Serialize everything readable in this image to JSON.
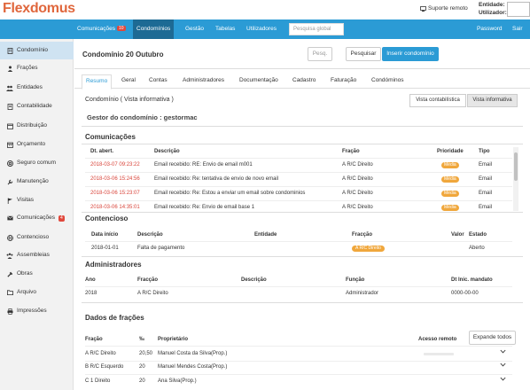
{
  "brand": {
    "part1": "Flex",
    "part2": "domus"
  },
  "topbar": {
    "remote_label": "Suporte remoto",
    "entity_label": "Entidade:",
    "user_label": "Utilizador:"
  },
  "nav": {
    "items": [
      {
        "label": "Comunicações",
        "badge": "10"
      },
      {
        "label": "Condomínios"
      },
      {
        "label": "Gestão"
      },
      {
        "label": "Tabelas"
      },
      {
        "label": "Utilizadores"
      }
    ],
    "search_placeholder": "Pesquisa global",
    "password": "Password",
    "logout": "Sair"
  },
  "sidebar": {
    "items": [
      {
        "label": "Condomínio",
        "icon": "building-icon"
      },
      {
        "label": "Frações",
        "icon": "user-icon"
      },
      {
        "label": "Entidades",
        "icon": "users-icon"
      },
      {
        "label": "Contabilidade",
        "icon": "book-icon"
      },
      {
        "label": "Distribuição",
        "icon": "calendar-icon"
      },
      {
        "label": "Orçamento",
        "icon": "calendar-icon"
      },
      {
        "label": "Seguro comum",
        "icon": "lifebuoy-icon"
      },
      {
        "label": "Manutenção",
        "icon": "wrench-icon"
      },
      {
        "label": "Visitas",
        "icon": "flag-icon"
      },
      {
        "label": "Comunicações",
        "icon": "envelope-icon",
        "badge": "4"
      },
      {
        "label": "Contencioso",
        "icon": "globe-icon"
      },
      {
        "label": "Assembleias",
        "icon": "group-icon"
      },
      {
        "label": "Obras",
        "icon": "tools-icon"
      },
      {
        "label": "Arquivo",
        "icon": "folder-icon"
      },
      {
        "label": "Impressões",
        "icon": "print-icon"
      }
    ]
  },
  "page": {
    "title": "Condomínio 20 Outubro",
    "search_placeholder": "Pesq.",
    "search_button": "Pesquisar",
    "insert_button": "Inserir condomínio"
  },
  "tabs": [
    "Resumo",
    "Geral",
    "Contas",
    "Administradores",
    "Documentação",
    "Cadastro",
    "Faturação",
    "Condóminos"
  ],
  "view": {
    "label": "Condomínio ( Vista informativa )",
    "btn_accounting": "Vista contabilística",
    "btn_info": "Vista informativa"
  },
  "gestor": "Gestor do condomínio : gestormac",
  "comunicacoes": {
    "title": "Comunicações",
    "headers": [
      "Dt. abert.",
      "Descrição",
      "Fração",
      "Prioridade",
      "Tipo"
    ],
    "rows": [
      {
        "date": "2018-03-07 09:23:22",
        "desc": "Email recebido: RE: Envio de email m001",
        "fracao": "A R/C Direito",
        "prio": "Média",
        "tipo": "Email"
      },
      {
        "date": "2018-03-06 15:24:56",
        "desc": "Email recebido: Re: tentativa de envio de novo email",
        "fracao": "A R/C Direito",
        "prio": "Média",
        "tipo": "Email"
      },
      {
        "date": "2018-03-06 15:23:07",
        "desc": "Email recebido: Re: Estou a enviar um email sobre condominios",
        "fracao": "A R/C Direito",
        "prio": "Média",
        "tipo": "Email"
      },
      {
        "date": "2018-03-06 14:35:01",
        "desc": "Email recebido: Re: Envio de email base 1",
        "fracao": "A R/C Direito",
        "prio": "Média",
        "tipo": "Email"
      }
    ]
  },
  "contencioso": {
    "title": "Contencioso",
    "headers": [
      "Data início",
      "Descrição",
      "Entidade",
      "Fracção",
      "Valor",
      "Estado"
    ],
    "rows": [
      {
        "date": "2018-01-01",
        "desc": "Falta de pagamento",
        "entidade": "",
        "fracao": "A R/C Direito",
        "valor": "",
        "estado": "Aberto"
      }
    ]
  },
  "administradores": {
    "title": "Administradores",
    "headers": [
      "Ano",
      "Fracção",
      "Descrição",
      "Função",
      "Dt Inic. mandato"
    ],
    "rows": [
      {
        "ano": "2018",
        "fracao": "A R/C Direito",
        "desc": "",
        "funcao": "Administrador",
        "dt": "0000-00-00"
      }
    ]
  },
  "fracoes": {
    "title": "Dados de frações",
    "expand_button": "Expande todos",
    "headers": [
      "Fração",
      "‰",
      "Proprietário",
      "Acesso remoto"
    ],
    "rows": [
      {
        "fracao": "A R/C Direito",
        "perm": "20,50",
        "prop": "Manuel Costa da Silva(Prop.)"
      },
      {
        "fracao": "B R/C Esquerdo",
        "perm": "20",
        "prop": "Manuel Mendes Costa(Prop.)"
      },
      {
        "fracao": "C 1 Direito",
        "perm": "20",
        "prop": "Ana Silva(Prop.)"
      }
    ]
  },
  "colors": {
    "accent": "#2b9bd5",
    "nav_active": "#1d6a94",
    "logo": "#e0673d",
    "badge": "#e0483c",
    "priority": "#f0a73c",
    "date_red": "#d9443a"
  }
}
